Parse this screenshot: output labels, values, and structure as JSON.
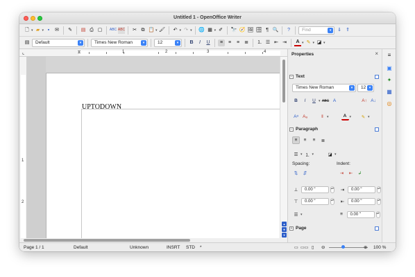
{
  "window": {
    "title": "Untitled 1 - OpenOffice Writer"
  },
  "toolbar1": {
    "find_placeholder": "Find"
  },
  "toolbar2": {
    "paragraph_style": "Default",
    "font_name": "Times New Roman",
    "font_size": "12"
  },
  "ruler": {
    "h_numbers": [
      "1",
      "2",
      "3",
      "4"
    ],
    "v_numbers": [
      "1",
      "2"
    ]
  },
  "document": {
    "text": "UPTODOWN"
  },
  "sidebar": {
    "title": "Properties",
    "close_label": "×",
    "sections": {
      "text": {
        "title": "Text",
        "font_name": "Times New Roman",
        "font_size": "12"
      },
      "paragraph": {
        "title": "Paragraph",
        "spacing_label": "Spacing:",
        "indent_label": "Indent:",
        "spacing_above": "0.00 \"",
        "spacing_below": "0.00 \"",
        "indent_before": "0.00 \"",
        "indent_after": "0.00 \"",
        "first_line": "0.00 \""
      },
      "page": {
        "title": "Page"
      }
    }
  },
  "statusbar": {
    "page": "Page 1 / 1",
    "style": "Default",
    "language": "Unknown",
    "insert_mode": "INSRT",
    "selection_mode": "STD",
    "modified_mark": "*",
    "zoom": "100 %"
  },
  "colors": {
    "accent": "#3b82f6",
    "nav_blue": "#2d5ec9",
    "close": "#fe5f57",
    "minimize": "#febc2e",
    "zoom": "#28c840"
  }
}
